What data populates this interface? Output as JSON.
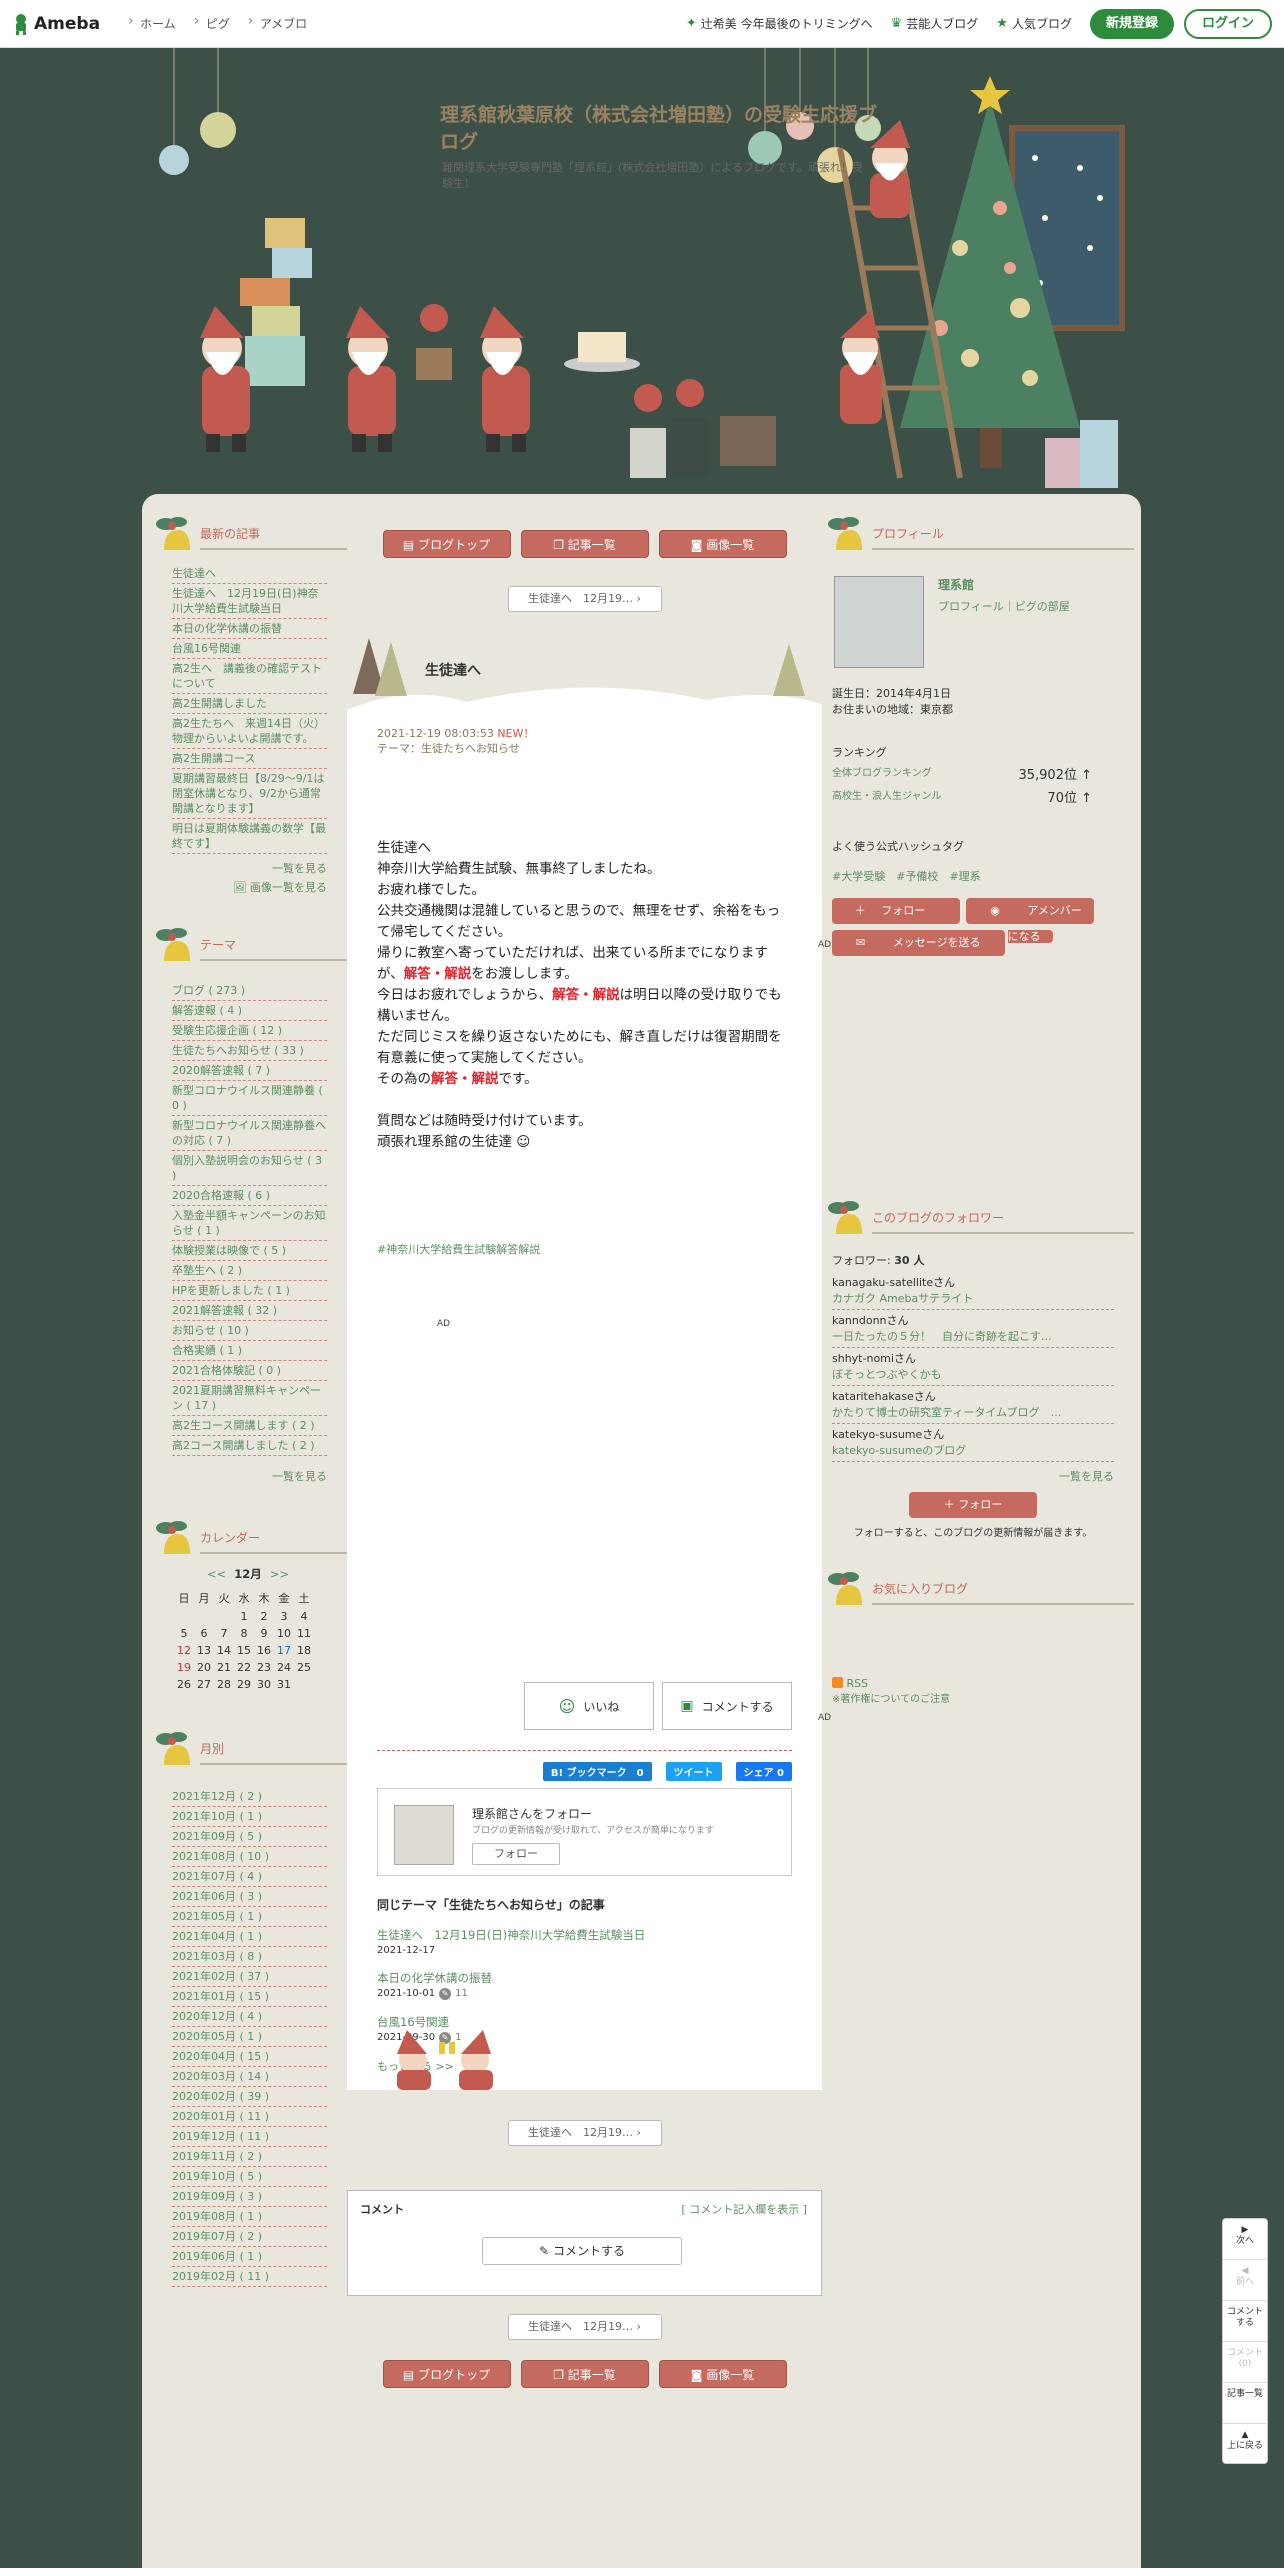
{
  "topbar": {
    "logo": "Ameba",
    "nav": [
      "ホーム",
      "ピグ",
      "アメブロ"
    ],
    "links": [
      "辻希美 今年最後のトリミングへ",
      "芸能人ブログ",
      "人気ブログ"
    ],
    "register": "新規登録",
    "login": "ログイン"
  },
  "blog": {
    "title": "理系館秋葉原校（株式会社増田塾）の受験生応援ブログ",
    "desc": "難関理系大学受験専門塾「理系館」(株式会社増田塾）によるブログです。頑張れ！受験生！"
  },
  "recent": {
    "title": "最新の記事",
    "items": [
      "生徒達へ",
      "生徒達へ　12月19日(日)神奈川大学給費生試験当日",
      "本日の化学休講の振替",
      "台風16号関連",
      "高2生へ　講義後の確認テストについて",
      "高2生開講しました",
      "高2生たちへ　来週14日（火）物理からいよいよ開講です。",
      "高2生開講コース",
      "夏期講習最終日【8/29～9/1は閉室休講となり、9/2から通常開講となります】",
      "明日は夏期体験講義の数学【最終です】"
    ],
    "more": "一覧を見る",
    "more_img": "画像一覧を見る"
  },
  "theme": {
    "title": "テーマ",
    "items": [
      "ブログ ( 273 )",
      "解答速報 ( 4 )",
      "受験生応援企画 ( 12 )",
      "生徒たちへお知らせ ( 33 )",
      "2020解答速報 ( 7 )",
      "新型コロナウイルス関連静養 ( 0 )",
      "新型コロナウイルス関連静養への対応 ( 7 )",
      "個別入塾説明会のお知らせ ( 3 )",
      "2020合格速報 ( 6 )",
      "入塾金半額キャンペーンのお知らせ ( 1 )",
      "体験授業は映像で ( 5 )",
      "卒塾生へ ( 2 )",
      "HPを更新しました ( 1 )",
      "2021解答速報 ( 32 )",
      "お知らせ ( 10 )",
      "合格実績 ( 1 )",
      "2021合格体験記 ( 0 )",
      "2021夏期講習無料キャンペーン ( 17 )",
      "高2生コース開講します ( 2 )",
      "高2コース開講しました ( 2 )"
    ],
    "more": "一覧を見る"
  },
  "calendar": {
    "title": "カレンダー",
    "prev": "<<",
    "month": "12月",
    "next": ">>",
    "weekdays": [
      "日",
      "月",
      "火",
      "水",
      "木",
      "金",
      "土"
    ],
    "weeks": [
      [
        "",
        "",
        "",
        "1",
        "2",
        "3",
        "4"
      ],
      [
        "5",
        "6",
        "7",
        "8",
        "9",
        "10",
        "11"
      ],
      [
        "12",
        "13",
        "14",
        "15",
        "16",
        "17",
        "18"
      ],
      [
        "19",
        "20",
        "21",
        "22",
        "23",
        "24",
        "25"
      ],
      [
        "26",
        "27",
        "28",
        "29",
        "30",
        "31",
        ""
      ]
    ]
  },
  "monthly": {
    "title": "月別",
    "items": [
      "2021年12月 ( 2 )",
      "2021年10月 ( 1 )",
      "2021年09月 ( 5 )",
      "2021年08月 ( 10 )",
      "2021年07月 ( 4 )",
      "2021年06月 ( 3 )",
      "2021年05月 ( 1 )",
      "2021年04月 ( 1 )",
      "2021年03月 ( 8 )",
      "2021年02月 ( 37 )",
      "2021年01月 ( 15 )",
      "2020年12月 ( 4 )",
      "2020年05月 ( 1 )",
      "2020年04月 ( 15 )",
      "2020年03月 ( 14 )",
      "2020年02月 ( 39 )",
      "2020年01月 ( 11 )",
      "2019年12月 ( 11 )",
      "2019年11月 ( 2 )",
      "2019年10月 ( 5 )",
      "2019年09月 ( 3 )",
      "2019年08月 ( 1 )",
      "2019年07月 ( 2 )",
      "2019年06月 ( 1 )",
      "2019年02月 ( 11 )"
    ]
  },
  "main": {
    "btns": [
      "ブログトップ",
      "記事一覧",
      "画像一覧"
    ],
    "pager": "生徒達へ　12月19…",
    "entry_title": "生徒達へ",
    "date": "2021-12-19 08:03:53",
    "new": "NEW！",
    "theme_label": "テーマ：",
    "theme": "生徒たちへお知らせ",
    "b1": "生徒達へ",
    "b2": "神奈川大学給費生試験、無事終了しましたね。",
    "b3": "お疲れ様でした。",
    "b4": "公共交通機関は混雑していると思うので、無理をせず、余裕をもって帰宅してください。",
    "b5a": "帰りに教室へ寄っていただければ、出来ている所までになりますが、",
    "red": "解答・解説",
    "b5b": "をお渡しします。",
    "b6a": "今日はお疲れでしょうから、",
    "b6b": "は明日以降の受け取りでも構いません。",
    "b7": "ただ同じミスを繰り返さないためにも、解き直しだけは復習期間を有意義に使って実施してください。",
    "b8a": "その為の",
    "b8b": "です。",
    "b9": "質問などは随時受け付けています。",
    "b10": "頑張れ理系館の生徒達",
    "hashtag": "#神奈川大学給費生試験解答解説",
    "ad": "AD",
    "like": "いいね",
    "comment": "コメントする",
    "hatena": "B! ブックマーク　0",
    "tweet": "ツイート",
    "fbshare": "シェア 0",
    "follow_title": "理系館さんをフォロー",
    "follow_desc": "ブログの更新情報が受け取れて、アクセスが簡単になります",
    "follow_btn": "フォロー",
    "same_title": "同じテーマ「生徒たちへお知らせ」の記事",
    "same": [
      {
        "t": "生徒達へ　12月19日(日)神奈川大学給費生試験当日",
        "d": "2021-12-17",
        "c": ""
      },
      {
        "t": "本日の化学休講の振替",
        "d": "2021-10-01",
        "c": "11"
      },
      {
        "t": "台風16号関連",
        "d": "2021-09-30",
        "c": "1"
      }
    ],
    "same_more": "もっと見る >>",
    "cbox_title": "コメント",
    "cbox_show": "[ コメント記入欄を表示 ]",
    "cbox_btn": "コメントする"
  },
  "profile": {
    "title": "プロフィール",
    "name": "理系館",
    "links": "プロフィール｜ピグの部屋",
    "birth": "誕生日：2014年4月1日",
    "place": "お住まいの地域：東京都",
    "rank_title": "ランキング",
    "r1": "全体ブログランキング",
    "r1v": "35,902位 ↑",
    "r2": "高校生・浪人生ジャンル",
    "r2v": "70位 ↑",
    "tags_title": "よく使う公式ハッシュタグ",
    "tags": "#大学受験　#予備校　#理系",
    "follow": "フォロー",
    "member": "アメンバーになる",
    "message": "メッセージを送る"
  },
  "followers": {
    "title": "このブログのフォロワー",
    "count_label": "フォロワー:",
    "count": "30 人",
    "items": [
      {
        "n": "kanagaku-satelliteさん",
        "b": "カナガク Amebaサテライト"
      },
      {
        "n": "kanndonnさん",
        "b": "一日たったの５分！　自分に奇跡を起こす…"
      },
      {
        "n": "shhyt-nomiさん",
        "b": "ぼそっとつぶやくかも"
      },
      {
        "n": "kataritehakaseさん",
        "b": "かたりて博士の研究室ティータイムブログ　…"
      },
      {
        "n": "katekyo-susumeさん",
        "b": "katekyo-susumeのブログ"
      }
    ],
    "more": "一覧を見る",
    "btn": "フォロー",
    "note": "フォローすると、このブログの更新情報が届きます。"
  },
  "fav": {
    "title": "お気に入りブログ",
    "rss": "RSS",
    "note": "※著作権についてのご注意"
  },
  "floatbar": [
    "次へ",
    "前へ",
    "コメントする",
    "コメント(0)",
    "記事一覧",
    "上に戻る"
  ],
  "colors": {
    "accent": "#2d8c3c",
    "red": "#c56a5e",
    "bg": "#3c5048"
  }
}
